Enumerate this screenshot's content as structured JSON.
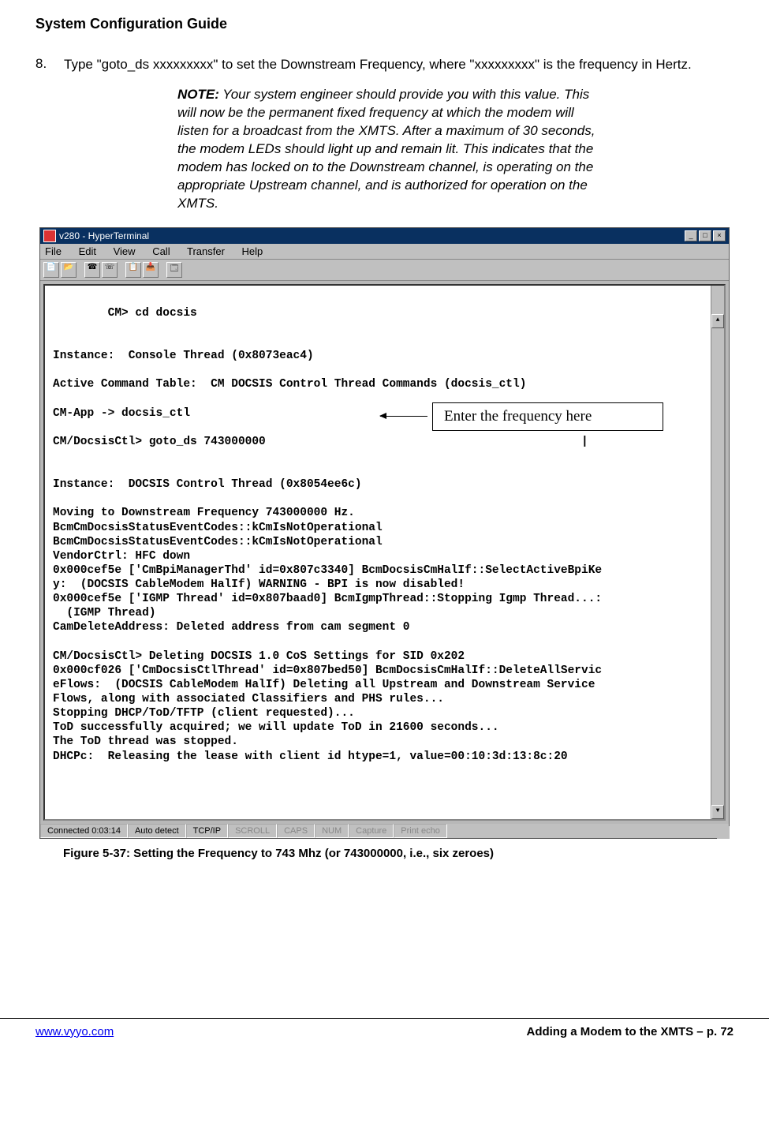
{
  "header": {
    "title": "System Configuration Guide"
  },
  "step": {
    "number": "8.",
    "text": "Type \"goto_ds xxxxxxxxx\" to set the Downstream Frequency, where \"xxxxxxxxx\" is the frequency in Hertz."
  },
  "note": {
    "label": "NOTE:",
    "body": " Your system engineer should provide you with this value. This will now be the permanent fixed frequency at which the modem will listen for a broadcast from the XMTS. After a maximum of 30 seconds, the modem LEDs should light up and remain lit. This indicates that the modem has locked on to the Downstream channel, is operating on the appropriate Upstream channel, and is authorized for operation on the XMTS."
  },
  "hyperterminal": {
    "title": "v280 - HyperTerminal",
    "menus": [
      "File",
      "Edit",
      "View",
      "Call",
      "Transfer",
      "Help"
    ],
    "winbuttons": [
      "_",
      "□",
      "×"
    ],
    "terminal_text": "CM> cd docsis\n\n\nInstance:  Console Thread (0x8073eac4)\n\nActive Command Table:  CM DOCSIS Control Thread Commands (docsis_ctl)\n\nCM-App -> docsis_ctl\n\nCM/DocsisCtl> goto_ds 743000000                                              |\n\n\nInstance:  DOCSIS Control Thread (0x8054ee6c)\n\nMoving to Downstream Frequency 743000000 Hz.\nBcmCmDocsisStatusEventCodes::kCmIsNotOperational\nBcmCmDocsisStatusEventCodes::kCmIsNotOperational\nVendorCtrl: HFC down\n0x000cef5e ['CmBpiManagerThd' id=0x807c3340] BcmDocsisCmHalIf::SelectActiveBpiKe\ny:  (DOCSIS CableModem HalIf) WARNING - BPI is now disabled!\n0x000cef5e ['IGMP Thread' id=0x807baad0] BcmIgmpThread::Stopping Igmp Thread...:\n  (IGMP Thread)\nCamDeleteAddress: Deleted address from cam segment 0\n\nCM/DocsisCtl> Deleting DOCSIS 1.0 CoS Settings for SID 0x202\n0x000cf026 ['CmDocsisCtlThread' id=0x807bed50] BcmDocsisCmHalIf::DeleteAllServic\neFlows:  (DOCSIS CableModem HalIf) Deleting all Upstream and Downstream Service\nFlows, along with associated Classifiers and PHS rules...\nStopping DHCP/ToD/TFTP (client requested)...\nToD successfully acquired; we will update ToD in 21600 seconds...\nThe ToD thread was stopped.\nDHCPc:  Releasing the lease with client id htype=1, value=00:10:3d:13:8c:20",
    "statusbar": {
      "connected": "Connected 0:03:14",
      "detect": "Auto detect",
      "protocol": "TCP/IP",
      "indicators": [
        "SCROLL",
        "CAPS",
        "NUM",
        "Capture",
        "Print echo"
      ]
    }
  },
  "callout": {
    "text": "Enter the frequency here"
  },
  "figure": {
    "caption": "Figure 5-37: Setting the Frequency to 743 Mhz (or 743000000, i.e., six zeroes)"
  },
  "footer": {
    "url_text": "www.vyyo.com",
    "right": "Adding a Modem to the XMTS – p. 72"
  }
}
